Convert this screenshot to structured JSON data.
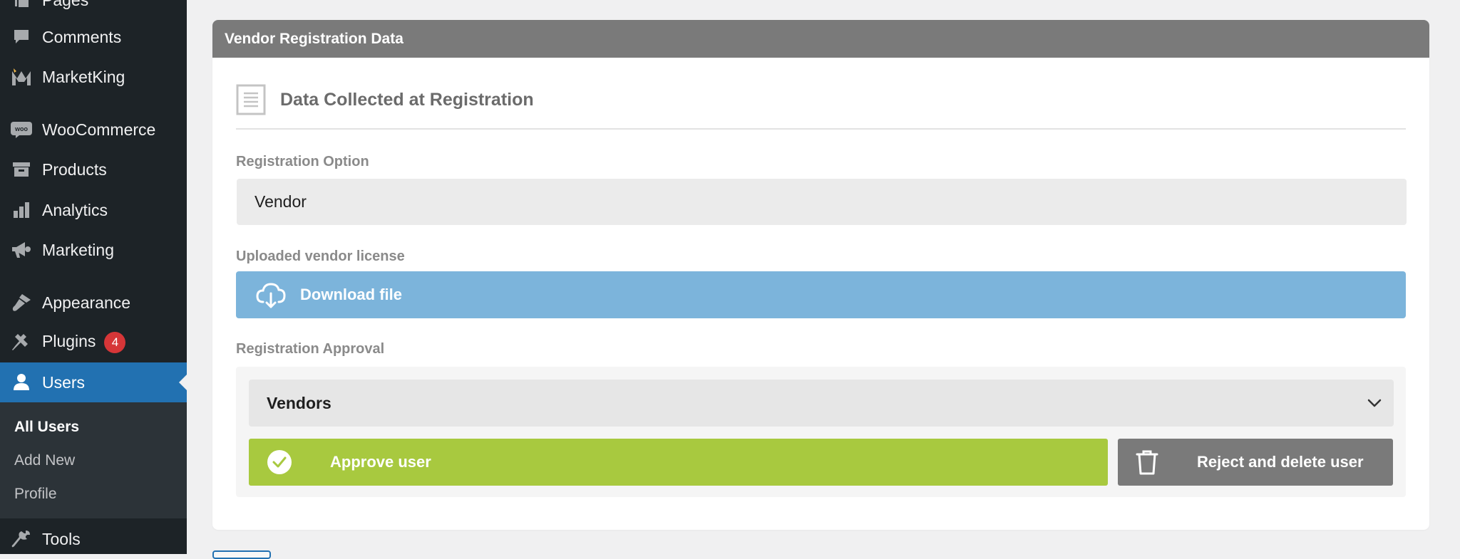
{
  "sidebar": {
    "items": [
      {
        "label": "Pages",
        "icon": "pages-icon"
      },
      {
        "label": "Comments",
        "icon": "comments-icon"
      },
      {
        "label": "MarketKing",
        "icon": "marketking-icon"
      },
      {
        "label": "WooCommerce",
        "icon": "woocommerce-icon"
      },
      {
        "label": "Products",
        "icon": "products-icon"
      },
      {
        "label": "Analytics",
        "icon": "analytics-icon"
      },
      {
        "label": "Marketing",
        "icon": "marketing-icon"
      },
      {
        "label": "Appearance",
        "icon": "appearance-icon"
      },
      {
        "label": "Plugins",
        "icon": "plugins-icon",
        "badge": "4"
      },
      {
        "label": "Users",
        "icon": "users-icon",
        "active": true
      },
      {
        "label": "Tools",
        "icon": "tools-icon"
      }
    ],
    "submenu": [
      {
        "label": "All Users",
        "current": true
      },
      {
        "label": "Add New"
      },
      {
        "label": "Profile"
      }
    ]
  },
  "card": {
    "header": "Vendor Registration Data",
    "section_title": "Data Collected at Registration",
    "registration_option_label": "Registration Option",
    "registration_option_value": "Vendor",
    "license_label": "Uploaded vendor license",
    "download_label": "Download file",
    "approval_label": "Registration Approval",
    "approval_select_value": "Vendors",
    "approve_label": "Approve user",
    "reject_label": "Reject and delete user"
  },
  "colors": {
    "sidebar_bg": "#1d2327",
    "active_item": "#2271b1",
    "header_bg": "#7a7a7a",
    "download_bg": "#7cb4db",
    "approve_bg": "#a8c93f",
    "reject_bg": "#7a7a7a",
    "badge_bg": "#d63638"
  }
}
